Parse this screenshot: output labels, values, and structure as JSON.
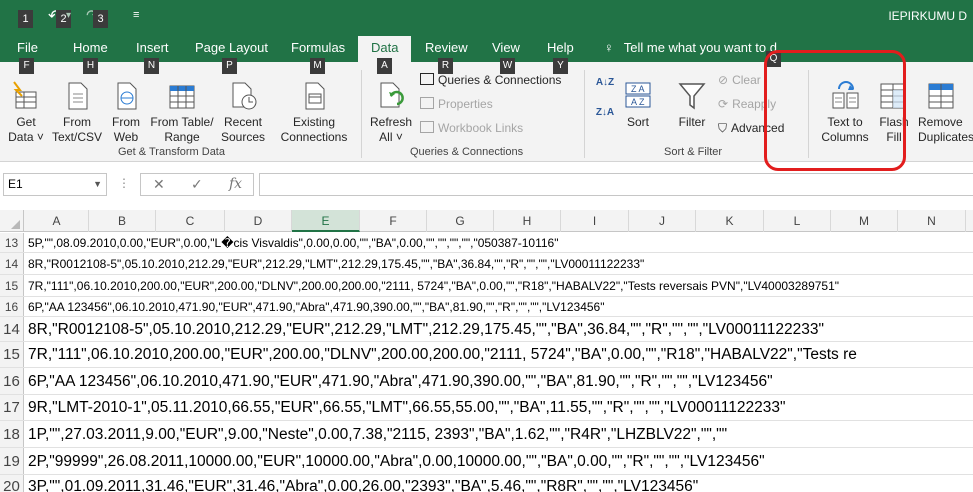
{
  "titlebar": {
    "keytips": [
      "1",
      "2",
      "3"
    ],
    "title": "IEPIRKUMU D"
  },
  "tabs": [
    {
      "label": "File",
      "key": "F"
    },
    {
      "label": "Home",
      "key": "H"
    },
    {
      "label": "Insert",
      "key": "N"
    },
    {
      "label": "Page Layout",
      "key": "P"
    },
    {
      "label": "Formulas",
      "key": "M"
    },
    {
      "label": "Data",
      "key": "A"
    },
    {
      "label": "Review",
      "key": "R"
    },
    {
      "label": "View",
      "key": "W"
    },
    {
      "label": "Help",
      "key": "Y"
    }
  ],
  "tellme": "Tell me what you want to d",
  "extra_keytip": "Q",
  "ribbon": {
    "get_data": {
      "line1": "Get",
      "line2": "Data ˅"
    },
    "from_text": {
      "line1": "From",
      "line2": "Text/CSV"
    },
    "from_web": {
      "line1": "From",
      "line2": "Web"
    },
    "from_table": {
      "line1": "From Table/",
      "line2": "Range"
    },
    "recent_sources": {
      "line1": "Recent",
      "line2": "Sources"
    },
    "existing_conn": {
      "line1": "Existing",
      "line2": "Connections"
    },
    "group_get": "Get & Transform Data",
    "refresh": {
      "line1": "Refresh",
      "line2": "All ˅"
    },
    "queries_conn": "Queries & Connections",
    "properties": "Properties",
    "workbook_links": "Workbook Links",
    "group_queries": "Queries & Connections",
    "sort": "Sort",
    "filter": "Filter",
    "clear": "Clear",
    "reapply": "Reapply",
    "advanced": "Advanced",
    "group_sort": "Sort & Filter",
    "text_to_columns": {
      "line1": "Text to",
      "line2": "Columns"
    },
    "flash_fill": {
      "line1": "Flash",
      "line2": "Fill"
    },
    "remove_dup": {
      "line1": "Remove",
      "line2": "Duplicates"
    }
  },
  "formula_bar": {
    "name_box": "E1",
    "fx": "fx",
    "value": ""
  },
  "columns": [
    "A",
    "B",
    "C",
    "D",
    "E",
    "F",
    "G",
    "H",
    "I",
    "J",
    "K",
    "L",
    "M",
    "N"
  ],
  "rows_small": [
    {
      "num": "13",
      "text": "5P,\"\",08.09.2010,0.00,\"EUR\",0.00,\"L�cis Visvaldis\",0.00,0.00,\"\",\"BA\",0.00,\"\",\"\",\"\",\"\",\"050387-10116\""
    },
    {
      "num": "14",
      "text": "8R,\"R0012108-5\",05.10.2010,212.29,\"EUR\",212.29,\"LMT\",212.29,175.45,\"\",\"BA\",36.84,\"\",\"R\",\"\",\"\",\"LV00011122233\""
    },
    {
      "num": "15",
      "text": "7R,\"111\",06.10.2010,200.00,\"EUR\",200.00,\"DLNV\",200.00,200.00,\"2111, 5724\",\"BA\",0.00,\"\",\"R18\",\"HABALV22\",\"Tests reversais PVN\",\"LV40003289751\""
    },
    {
      "num": "16",
      "text": "6P,\"AA 123456\",06.10.2010,471.90,\"EUR\",471.90,\"Abra\",471.90,390.00,\"\",\"BA\",81.90,\"\",\"R\",\"\",\"\",\"LV123456\""
    }
  ],
  "rows_big": [
    {
      "num": "14",
      "text": "8R,\"R0012108-5\",05.10.2010,212.29,\"EUR\",212.29,\"LMT\",212.29,175.45,\"\",\"BA\",36.84,\"\",\"R\",\"\",\"\",\"LV00011122233\""
    },
    {
      "num": "15",
      "text": "7R,\"111\",06.10.2010,200.00,\"EUR\",200.00,\"DLNV\",200.00,200.00,\"2111, 5724\",\"BA\",0.00,\"\",\"R18\",\"HABALV22\",\"Tests re"
    },
    {
      "num": "16",
      "text": "6P,\"AA 123456\",06.10.2010,471.90,\"EUR\",471.90,\"Abra\",471.90,390.00,\"\",\"BA\",81.90,\"\",\"R\",\"\",\"\",\"LV123456\""
    },
    {
      "num": "17",
      "text": "9R,\"LMT-2010-1\",05.11.2010,66.55,\"EUR\",66.55,\"LMT\",66.55,55.00,\"\",\"BA\",11.55,\"\",\"R\",\"\",\"\",\"LV00011122233\""
    },
    {
      "num": "18",
      "text": "1P,\"\",27.03.2011,9.00,\"EUR\",9.00,\"Neste\",0.00,7.38,\"2115, 2393\",\"BA\",1.62,\"\",\"R4R\",\"LHZBLV22\",\"\",\"\""
    },
    {
      "num": "19",
      "text": "2P,\"99999\",26.08.2011,10000.00,\"EUR\",10000.00,\"Abra\",0.00,10000.00,\"\",\"BA\",0.00,\"\",\"R\",\"\",\"\",\"LV123456\""
    },
    {
      "num": "20",
      "text": "3P,\"\",01.09.2011,31.46,\"EUR\",31.46,\"Abra\",0.00,26.00,\"2393\",\"BA\",5.46,\"\",\"R8R\",\"\",\"\",\"LV123456\""
    }
  ],
  "colors": {
    "accent": "#217346",
    "highlight": "#e21d1d"
  }
}
